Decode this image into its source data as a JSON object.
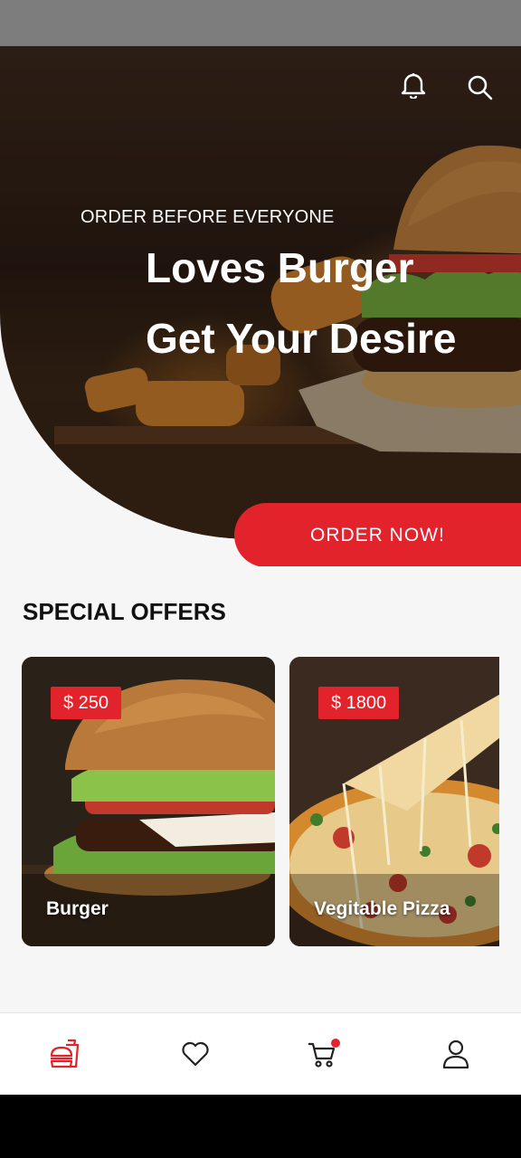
{
  "hero": {
    "subtitle": "ORDER BEFORE EVERYONE",
    "title_line1": "Loves Burger",
    "title_line2": "Get Your Desire",
    "order_button": "ORDER NOW!"
  },
  "icons": {
    "notifications": "bell-icon",
    "search": "search-icon"
  },
  "special_offers": {
    "title": "SPECIAL OFFERS",
    "items": [
      {
        "name": "Burger",
        "price": "$ 250"
      },
      {
        "name": "Vegitable Pizza",
        "price": "$ 1800"
      }
    ]
  },
  "bottom_nav": {
    "items": [
      {
        "icon": "food-icon",
        "active": true
      },
      {
        "icon": "heart-icon",
        "active": false
      },
      {
        "icon": "cart-icon",
        "active": false,
        "badge": true
      },
      {
        "icon": "profile-icon",
        "active": false
      }
    ]
  },
  "colors": {
    "accent": "#e2232b",
    "background": "#f6f6f6",
    "nav_inactive": "#222222"
  }
}
